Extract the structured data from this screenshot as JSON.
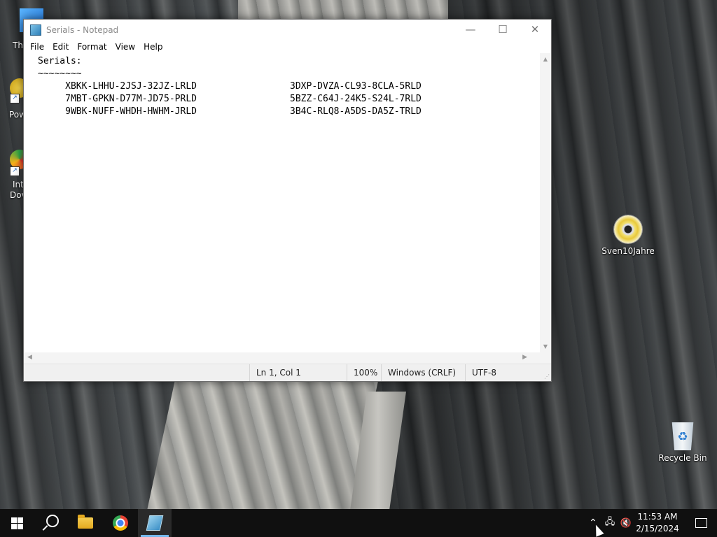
{
  "desktop": {
    "icons": [
      {
        "label": "Sven10Jahre",
        "icon": "cd-icon"
      },
      {
        "label": "Recycle Bin",
        "icon": "recycle-bin-icon"
      }
    ],
    "partial_icons": [
      {
        "label": "Th"
      },
      {
        "label": "Pow"
      },
      {
        "label_line1": "Int",
        "label_line2": "Dov"
      }
    ]
  },
  "notepad": {
    "title": "Serials - Notepad",
    "menu": [
      "File",
      "Edit",
      "Format",
      "View",
      "Help"
    ],
    "content": "Serials:\n~~~~~~~~\n     XBKK-LHHU-2JSJ-32JZ-LRLD                 3DXP-DVZA-CL93-8CLA-5RLD\n     7MBT-GPKN-D77M-JD75-PRLD                 5BZZ-C64J-24K5-S24L-7RLD\n     9WBK-NUFF-WHDH-HWHM-JRLD                 3B4C-RLQ8-A5DS-DA5Z-TRLD",
    "status": {
      "position": "Ln 1, Col 1",
      "zoom": "100%",
      "line_ending": "Windows (CRLF)",
      "encoding": "UTF-8"
    },
    "controls": {
      "minimize": "—",
      "maximize": "☐",
      "close": "✕"
    }
  },
  "taskbar": {
    "clock_time": "11:53 AM",
    "clock_date": "2/15/2024",
    "accent": "#76b9ed"
  }
}
